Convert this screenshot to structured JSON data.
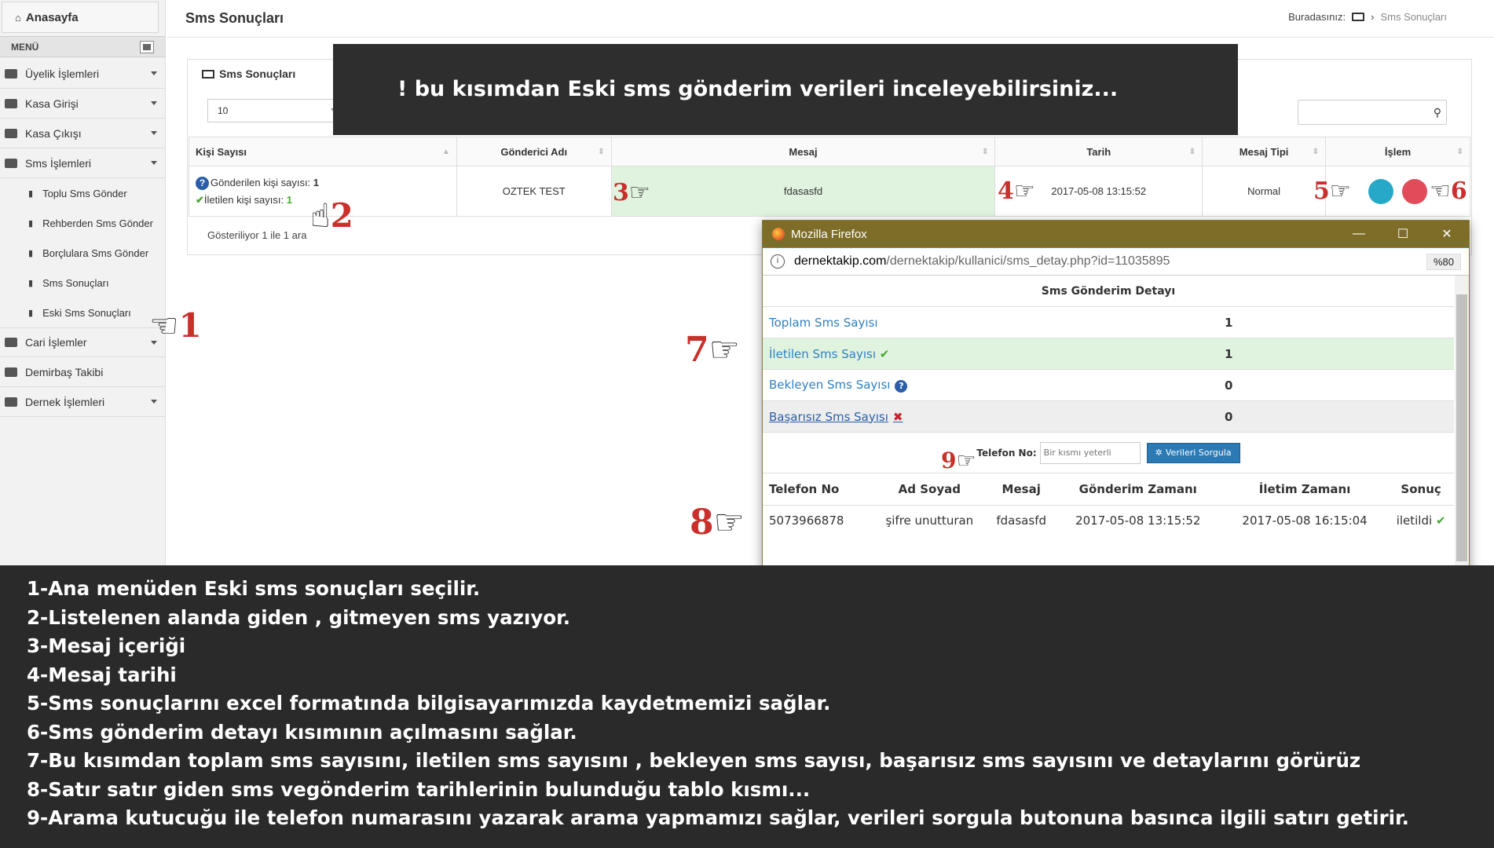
{
  "sidebar": {
    "home": "Anasayfa",
    "menu_header": "MENÜ",
    "items": [
      {
        "label": "Üyelik İşlemleri",
        "icon": "user-icon"
      },
      {
        "label": "Kasa Girişi",
        "icon": "briefcase-icon"
      },
      {
        "label": "Kasa Çıkışı",
        "icon": "briefcase-icon"
      },
      {
        "label": "Sms İşlemleri",
        "icon": "envelope-icon"
      }
    ],
    "sub_items": [
      "Toplu Sms Gönder",
      "Rehberden Sms Gönder",
      "Borçlulara Sms Gönder",
      "Sms Sonuçları",
      "Eski Sms Sonuçları"
    ],
    "items_after": [
      {
        "label": "Cari İşlemler",
        "icon": "calculator-icon"
      },
      {
        "label": "Demirbaş Takibi",
        "icon": "barcode-icon"
      },
      {
        "label": "Dernek İşlemleri",
        "icon": "calculator-icon"
      }
    ]
  },
  "header": {
    "title": "Sms Sonuçları",
    "breadcrumb_label": "Buradasınız:",
    "breadcrumb_current": "Sms Sonuçları"
  },
  "portlet": {
    "title": "Sms Sonuçları",
    "page_size": "10",
    "columns": [
      "Kişi Sayısı",
      "Gönderici Adı",
      "Mesaj",
      "Tarih",
      "Mesaj Tipi",
      "İşlem"
    ],
    "row": {
      "sent_label": "Gönderilen kişi sayısı:",
      "sent_value": "1",
      "delivered_label": "İletilen kişi sayısı:",
      "delivered_value": "1",
      "sender": "OZTEK TEST",
      "message": "fdasasfd",
      "date": "2017-05-08 13:15:52",
      "type": "Normal"
    },
    "footer": "Gösteriliyor 1 ile 1 ara"
  },
  "banner": "! bu kısımdan Eski sms gönderim  verileri inceleyebilirsiniz...",
  "popup": {
    "window_title": "Mozilla Firefox",
    "url_host": "dernektakip.com",
    "url_path": "/dernektakip/kullanici/sms_detay.php?id=11035895",
    "zoom": "%80",
    "title": "Sms Gönderim Detayı",
    "stats": [
      {
        "label": "Toplam Sms Sayısı",
        "value": "1"
      },
      {
        "label": "İletilen Sms Sayısı",
        "value": "1"
      },
      {
        "label": "Bekleyen Sms Sayısı",
        "value": "0"
      },
      {
        "label": "Başarısız Sms Sayısı",
        "value": "0"
      }
    ],
    "phone_label": "Telefon No:",
    "phone_placeholder": "Bir kısmı yeterli",
    "query_button": "Verileri Sorgula",
    "columns": [
      "Telefon No",
      "Ad Soyad",
      "Mesaj",
      "Gönderim Zamanı",
      "İletim Zamanı",
      "Sonuç"
    ],
    "row": [
      "5073966878",
      "şifre unutturan",
      "fdasasfd",
      "2017-05-08 13:15:52",
      "2017-05-08 16:15:04",
      "iletildi"
    ]
  },
  "notes": [
    "1-Ana menüden Eski sms sonuçları seçilir.",
    "2-Listelenen alanda giden , gitmeyen sms yazıyor.",
    "3-Mesaj içeriği",
    "4-Mesaj tarihi",
    "5-Sms sonuçlarını excel formatında bilgisayarımızda kaydetmemizi sağlar.",
    "6-Sms gönderim detayı kısımının açılmasını sağlar.",
    "7-Bu kısımdan toplam sms sayısını,  iletilen sms sayısını , bekleyen sms sayısı, başarısız sms sayısını ve detaylarını görürüz",
    "8-Satır satır giden sms vegönderim tarihlerinin bulunduğu tablo kısmı...",
    "9-Arama kutucuğu ile telefon numarasını yazarak arama yapmamızı sağlar, verileri sorgula butonuna basınca ilgili satırı getirir."
  ],
  "markers": [
    "1",
    "2",
    "3",
    "4",
    "5",
    "6",
    "7",
    "8",
    "9"
  ]
}
